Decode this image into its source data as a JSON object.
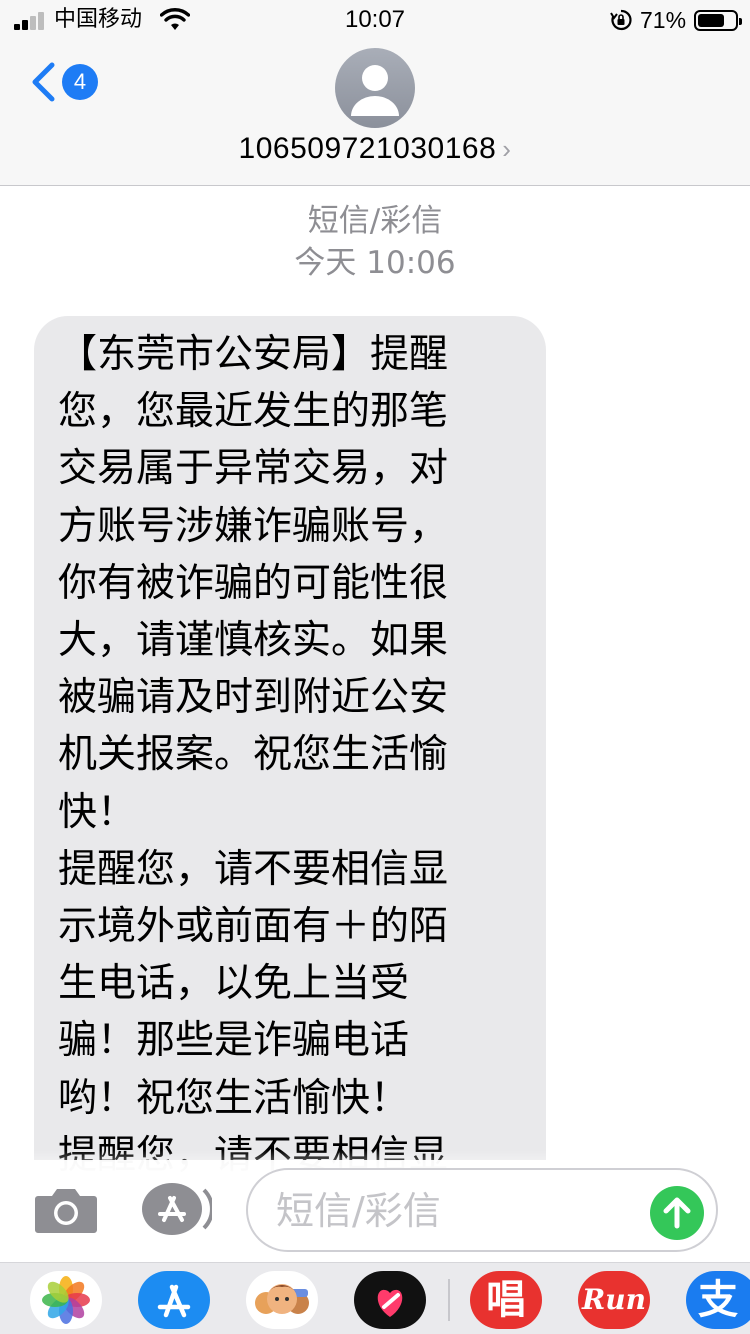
{
  "status_bar": {
    "carrier": "中国移动",
    "time": "10:07",
    "battery_percent": "71%",
    "battery_level": 0.71,
    "signal_bars": 2,
    "icons": [
      "signal-icon",
      "wifi-icon",
      "rotation-lock-icon",
      "battery-icon"
    ]
  },
  "header": {
    "back_badge": "4",
    "sender": "106509721030168",
    "sender_chevron": "›",
    "icons": [
      "back-chevron-icon",
      "contact-avatar-icon"
    ]
  },
  "conversation": {
    "message_type": "短信/彩信",
    "timestamp": "今天 10:06",
    "message": "【东莞市公安局】提醒\n您，您最近发生的那笔\n交易属于异常交易，对\n方账号涉嫌诈骗账号，\n你有被诈骗的可能性很\n大，请谨慎核实。如果\n被骗请及时到附近公安\n机关报案。祝您生活愉\n快！\n提醒您，请不要相信显\n示境外或前面有＋的陌\n生电话，以免上当受\n骗！那些是诈骗电话\n哟！祝您生活愉快！\n提醒您，请不要相信显"
  },
  "input": {
    "placeholder": "短信/彩信",
    "icons": [
      "camera-icon",
      "app-store-icon",
      "send-arrow-icon"
    ],
    "colors": {
      "send": "#34c759"
    }
  },
  "app_drawer": {
    "apps": [
      "photos-app-icon",
      "app-store-app-icon",
      "memoji-app-icon",
      "heart-app-icon",
      "chang-app-icon",
      "run-app-icon",
      "alipay-app-icon"
    ],
    "labels": {
      "chang": "唱",
      "run": "Run",
      "alipay": "支"
    }
  },
  "colors": {
    "accent": "#1e7cf5",
    "bubble": "#e9e9eb",
    "meta": "#8e8e93"
  }
}
